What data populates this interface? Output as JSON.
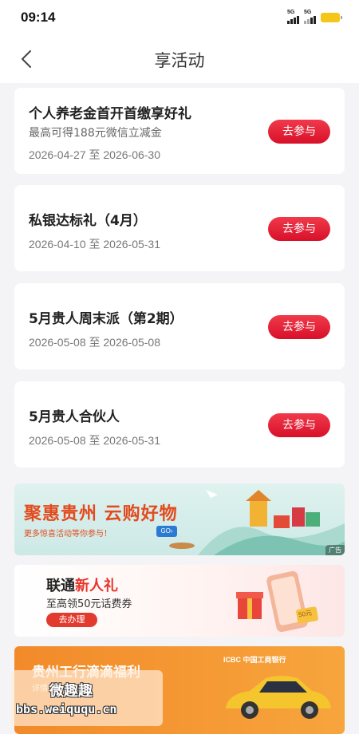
{
  "status_bar": {
    "time": "09:14",
    "signal1": "5G",
    "signal2": "5G"
  },
  "header": {
    "title": "享活动"
  },
  "activities": [
    {
      "title": "个人养老金首开首缴享好礼",
      "subtitle": "最高可得188元微信立减金",
      "date": "2026-04-27 至 2026-06-30",
      "action": "去参与"
    },
    {
      "title": "私银达标礼（4月）",
      "subtitle": "",
      "date": "2026-04-10 至 2026-05-31",
      "action": "去参与"
    },
    {
      "title": "5月贵人周末派（第2期）",
      "subtitle": "",
      "date": "2026-05-08 至 2026-05-08",
      "action": "去参与"
    },
    {
      "title": "5月贵人合伙人",
      "subtitle": "",
      "date": "2026-05-08 至 2026-05-31",
      "action": "去参与"
    }
  ],
  "banners": {
    "b1": {
      "headline": "聚惠贵州  云购好物",
      "sub": "更多惊喜活动等你参与！",
      "go": "GO›",
      "ad": "广告"
    },
    "b2": {
      "title_a": "联通",
      "title_b": "新人礼",
      "sub": "至高领50元话费券",
      "btn": "去办理",
      "coupon": "50元"
    },
    "b3": {
      "title": "贵州工行滴滴福利",
      "logo": "ICBC 中国工商银行",
      "detail": "详情"
    }
  },
  "watermark": {
    "line1": "微趣趣",
    "line2": "bbs.weiququ.cn"
  },
  "colors": {
    "accent": "#e01d35",
    "background": "#f4f4f6"
  }
}
